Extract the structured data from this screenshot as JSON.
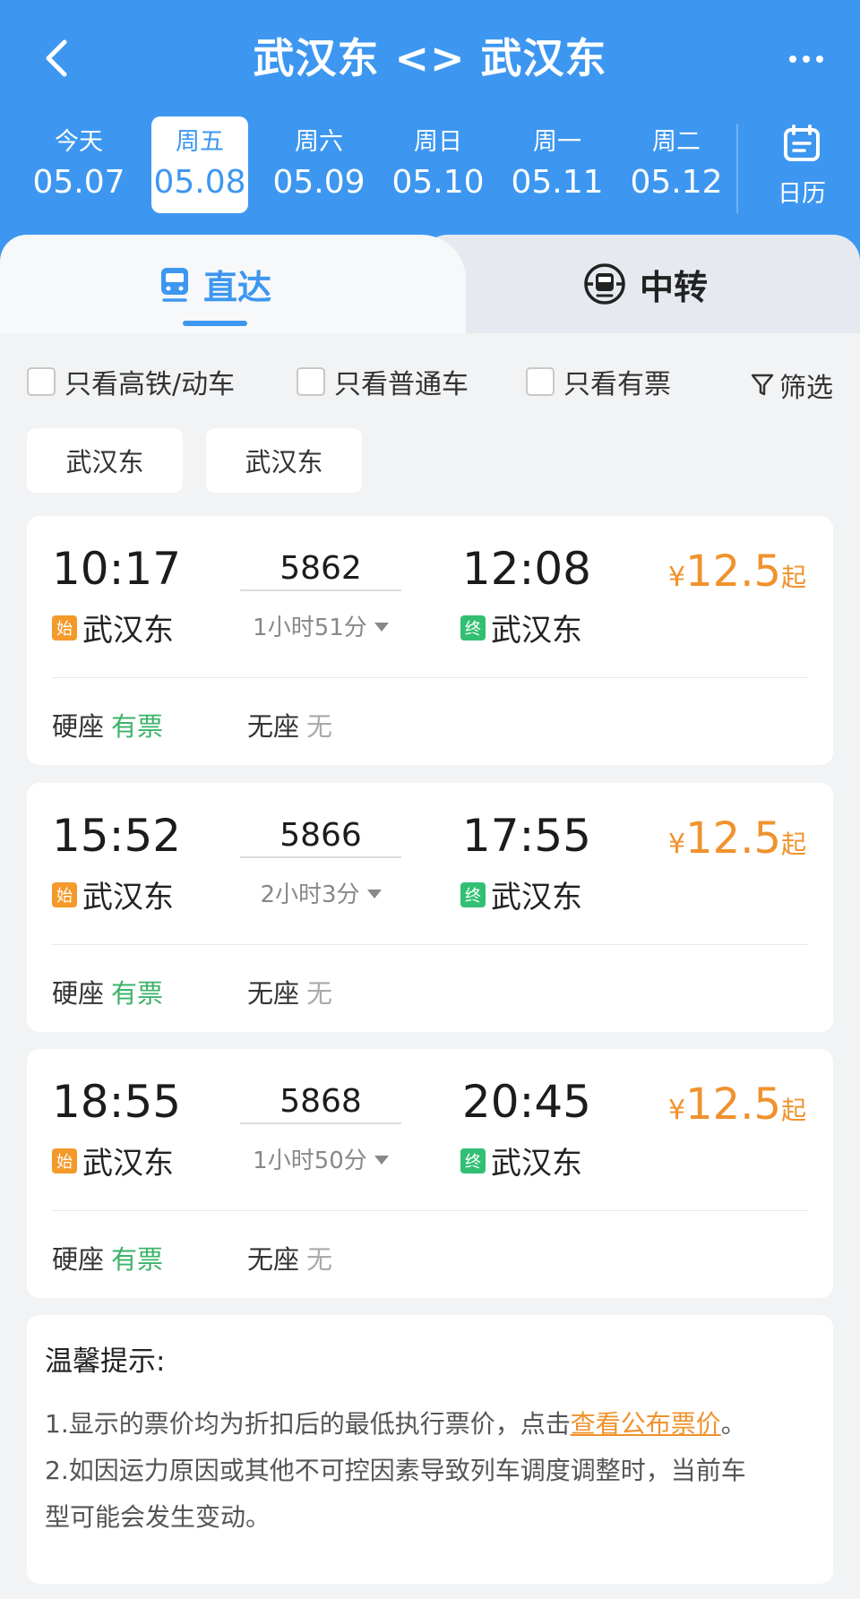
{
  "header": {
    "title": "武汉东 <> 武汉东",
    "back_icon": "chevron-left-icon",
    "more_icon": "more-dots-icon",
    "bg_color": "#3d97f0"
  },
  "dates": [
    {
      "weekday": "今天",
      "date": "05.07",
      "active": false
    },
    {
      "weekday": "周五",
      "date": "05.08",
      "active": true
    },
    {
      "weekday": "周六",
      "date": "05.09",
      "active": false
    },
    {
      "weekday": "周日",
      "date": "05.10",
      "active": false
    },
    {
      "weekday": "周一",
      "date": "05.11",
      "active": false
    },
    {
      "weekday": "周二",
      "date": "05.12",
      "active": false
    }
  ],
  "calendar": {
    "label": "日历",
    "icon": "calendar-icon"
  },
  "tabs": {
    "direct": {
      "label": "直达",
      "icon": "train-icon",
      "active": true
    },
    "transfer": {
      "label": "中转",
      "icon": "transfer-icon",
      "active": false
    }
  },
  "filters": {
    "highspeed": "只看高铁/动车",
    "normal": "只看普通车",
    "available": "只看有票",
    "filter_label": "筛选",
    "filter_icon": "funnel-icon"
  },
  "stations": {
    "from": "武汉东",
    "to": "武汉东"
  },
  "trains": [
    {
      "dep_time": "10:17",
      "arr_time": "12:08",
      "number": "5862",
      "duration": "1小时51分",
      "dep_station": "武汉东",
      "arr_station": "武汉东",
      "start_badge": "始",
      "end_badge": "终",
      "price_currency": "¥",
      "price": "12.5",
      "price_suffix": "起",
      "seat1_name": "硬座",
      "seat1_status": "有票",
      "seat2_name": "无座",
      "seat2_status": "无"
    },
    {
      "dep_time": "15:52",
      "arr_time": "17:55",
      "number": "5866",
      "duration": "2小时3分",
      "dep_station": "武汉东",
      "arr_station": "武汉东",
      "start_badge": "始",
      "end_badge": "终",
      "price_currency": "¥",
      "price": "12.5",
      "price_suffix": "起",
      "seat1_name": "硬座",
      "seat1_status": "有票",
      "seat2_name": "无座",
      "seat2_status": "无"
    },
    {
      "dep_time": "18:55",
      "arr_time": "20:45",
      "number": "5868",
      "duration": "1小时50分",
      "dep_station": "武汉东",
      "arr_station": "武汉东",
      "start_badge": "始",
      "end_badge": "终",
      "price_currency": "¥",
      "price": "12.5",
      "price_suffix": "起",
      "seat1_name": "硬座",
      "seat1_status": "有票",
      "seat2_name": "无座",
      "seat2_status": "无"
    }
  ],
  "notice": {
    "title": "温馨提示:",
    "line1": "1.显示的票价均为折扣后的最低执行票价，点击",
    "line1_link": "查看公布票价",
    "line1_end": "。",
    "line2": "2.如因运力原因或其他不可控因素导致列车调度调整时，当前车",
    "line3": "型可能会发生变动。"
  }
}
